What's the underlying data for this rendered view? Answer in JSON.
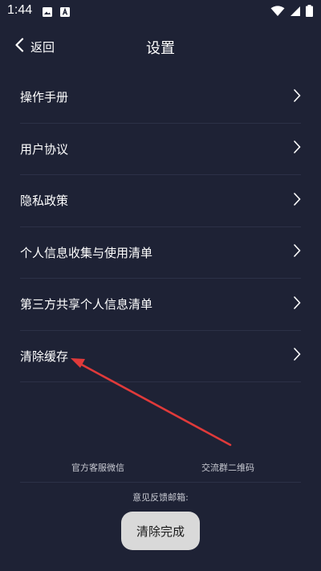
{
  "status_bar": {
    "time": "1:44"
  },
  "nav": {
    "back_label": "返回",
    "title": "设置"
  },
  "menu": {
    "items": [
      {
        "label": "操作手册"
      },
      {
        "label": "用户协议"
      },
      {
        "label": "隐私政策"
      },
      {
        "label": "个人信息收集与使用清单"
      },
      {
        "label": "第三方共享个人信息清单"
      },
      {
        "label": "清除缓存"
      }
    ]
  },
  "footer": {
    "wechat_label": "官方客服微信",
    "qrcode_label": "交流群二维码",
    "feedback_label": "意见反馈邮箱:"
  },
  "toast": {
    "message": "清除完成"
  },
  "colors": {
    "background": "#1e2235",
    "divider": "#2c3147",
    "annotation_arrow": "#e03a3a",
    "toast_bg": "#d9d9d9"
  }
}
